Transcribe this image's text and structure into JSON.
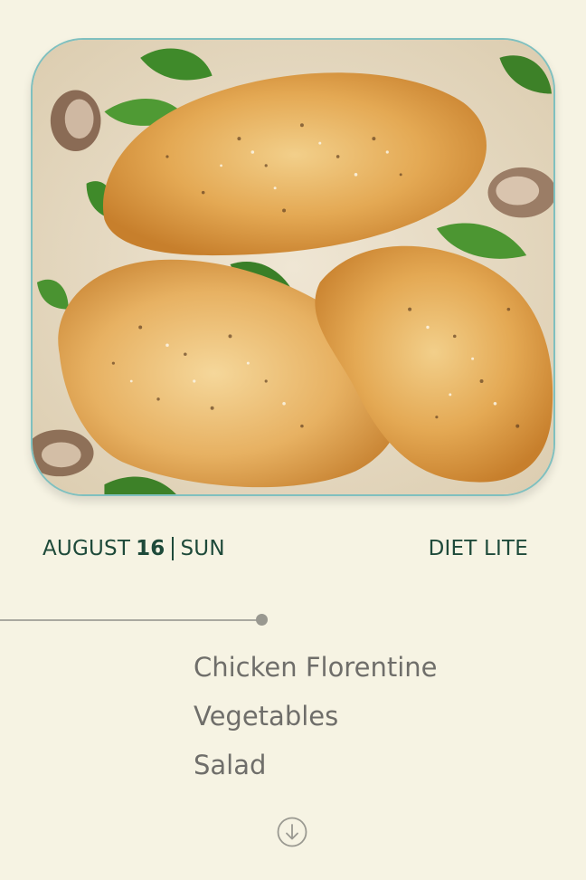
{
  "hero": {
    "image_name": "chicken-florentine-photo",
    "border_color": "#7fc0bf"
  },
  "date": {
    "month": "AUGUST",
    "day": "16",
    "weekday": "SUN"
  },
  "plan": {
    "label": "DIET LITE"
  },
  "menu": {
    "items": [
      "Chicken Florentine",
      "Vegetables",
      "Salad"
    ]
  },
  "scroll": {
    "icon": "arrow-down-circle-icon"
  },
  "colors": {
    "background": "#f6f3e3",
    "accent_text": "#1e4a3a",
    "menu_text": "#6f6e6a",
    "timeline": "#a9a8a0"
  }
}
